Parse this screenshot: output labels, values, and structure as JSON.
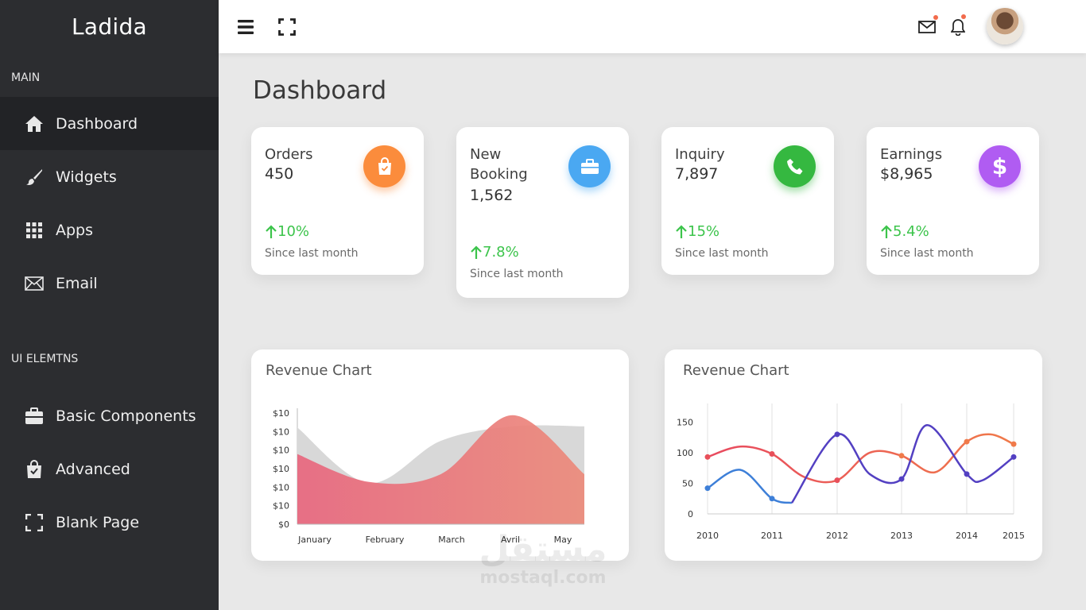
{
  "brand": "Ladida",
  "sidebar": {
    "main_label": "MAIN",
    "ui_label": "UI ELEMTNS",
    "main_items": [
      {
        "label": "Dashboard",
        "icon": "home-icon"
      },
      {
        "label": "Widgets",
        "icon": "brush-icon"
      },
      {
        "label": "Apps",
        "icon": "grid-icon"
      },
      {
        "label": "Email",
        "icon": "envelope-icon"
      }
    ],
    "ui_items": [
      {
        "label": "Basic Components",
        "icon": "briefcase-icon"
      },
      {
        "label": "Advanced",
        "icon": "bag-icon"
      },
      {
        "label": "Blank Page",
        "icon": "expand-icon"
      }
    ]
  },
  "topbar": {
    "menu_icon": "hamburger-icon",
    "fullscreen_icon": "fullscreen-icon",
    "mail_icon": "mail-icon",
    "bell_icon": "bell-icon"
  },
  "page_title": "Dashboard",
  "stats": [
    {
      "label": "Orders",
      "value": "450",
      "change": "10%",
      "since": "Since last month",
      "color": "#fb8c3c",
      "icon": "shopping-bag-icon"
    },
    {
      "label": "New Booking",
      "value": "1,562",
      "change": "7.8%",
      "since": "Since last month",
      "color": "#4aa8f2",
      "icon": "briefcase-icon"
    },
    {
      "label": "Inquiry",
      "value": "7,897",
      "change": "15%",
      "since": "Since last month",
      "color": "#35b840",
      "icon": "phone-icon"
    },
    {
      "label": "Earnings",
      "value": "$8,965",
      "change": "5.4%",
      "since": "Since last month",
      "color": "#b05cf2",
      "icon": "dollar-icon"
    }
  ],
  "chart_data": [
    {
      "type": "area",
      "title": "Revenue Chart",
      "categories": [
        "January",
        "February",
        "March",
        "Avril",
        "May"
      ],
      "y_tick_labels": [
        "$10",
        "$10",
        "$10",
        "$10",
        "$10",
        "$10",
        "$0"
      ],
      "series": [
        {
          "color": "#d8d8d8",
          "values": [
            0.87,
            0.37,
            0.75,
            0.88,
            0.88
          ]
        },
        {
          "color": "#ee7b84",
          "values": [
            0.63,
            0.38,
            0.45,
            0.98,
            0.45
          ]
        }
      ]
    },
    {
      "type": "line",
      "title": "Revenue Chart",
      "x": [
        2010,
        2011,
        2012,
        2013,
        2014,
        2015
      ],
      "ylim": [
        0,
        170
      ],
      "y_ticks": [
        0,
        50,
        100,
        150
      ],
      "grid": true,
      "series": [
        {
          "color": "#3d7fd8",
          "values": [
            42,
            25,
            130,
            57,
            65,
            93
          ]
        },
        {
          "color": "#e8505a",
          "values": [
            93,
            98,
            55,
            95,
            118,
            114
          ]
        },
        {
          "color": "#5340c2",
          "values": [
            42,
            25,
            130,
            57,
            65,
            93
          ]
        }
      ]
    }
  ]
}
